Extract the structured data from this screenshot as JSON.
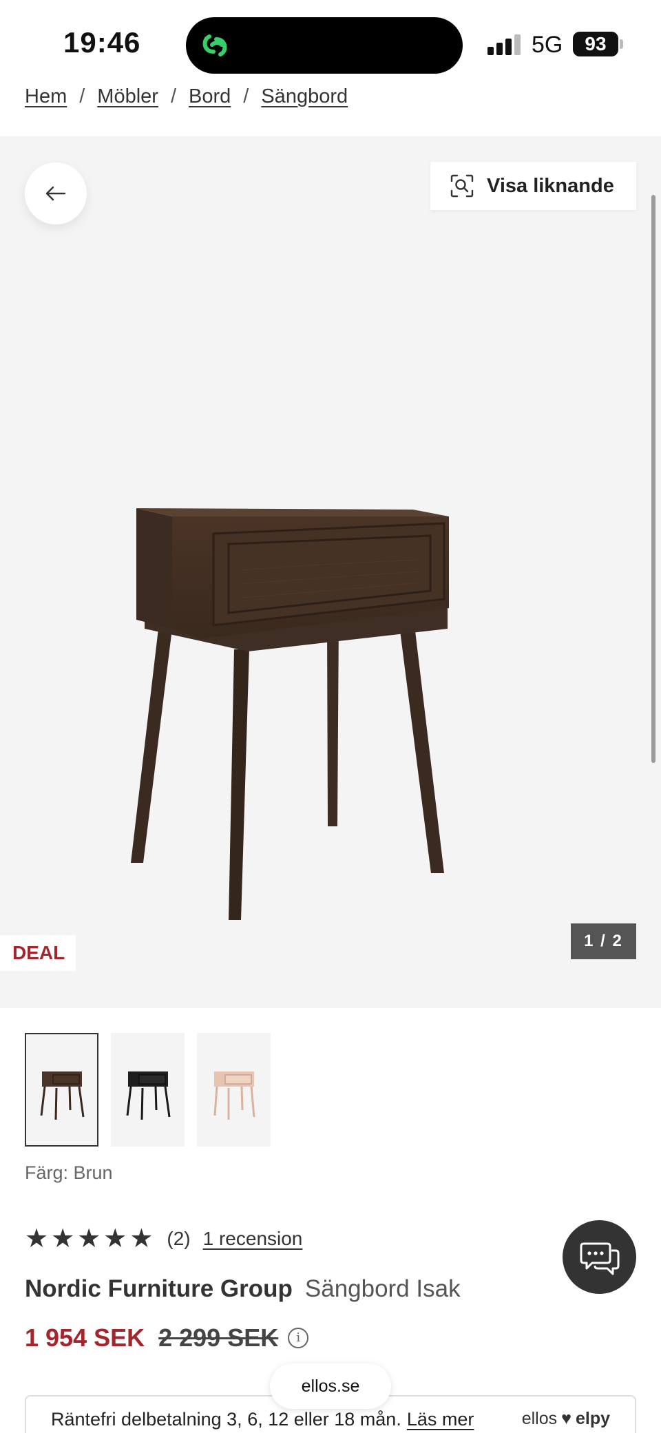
{
  "status_bar": {
    "time": "19:46",
    "network": "5G",
    "battery": "93"
  },
  "breadcrumb": {
    "items": [
      "Hem",
      "Möbler",
      "Bord",
      "Sängbord"
    ],
    "separator": "/"
  },
  "gallery": {
    "similar_label": "Visa liknande",
    "badge": "DEAL",
    "counter": "1 / 2",
    "thumbnails": [
      {
        "color": "#4a3528",
        "selected": true
      },
      {
        "color": "#1e1e1e",
        "selected": false
      },
      {
        "color": "#e7c4b2",
        "selected": false
      }
    ]
  },
  "product": {
    "color_label": "Färg: Brun",
    "rating": {
      "stars": 5,
      "count": "(2)",
      "review_link": "1 recension"
    },
    "brand": "Nordic Furniture Group",
    "name": "Sängbord Isak",
    "price_now": "1 954 SEK",
    "price_old": "2 299 SEK"
  },
  "site_pill": "ellos.se",
  "financing": {
    "text": "Räntefri delbetalning 3, 6, 12 eller 18 mån.",
    "link": "Läs mer",
    "logo_left": "ellos",
    "logo_right": "elpy"
  },
  "colors": {
    "accent_red": "#a4262c",
    "island_icon": "#35d06b"
  },
  "icons": [
    "arrow-left-icon",
    "visual-search-icon",
    "info-icon",
    "chat-icon",
    "heart-icon"
  ]
}
